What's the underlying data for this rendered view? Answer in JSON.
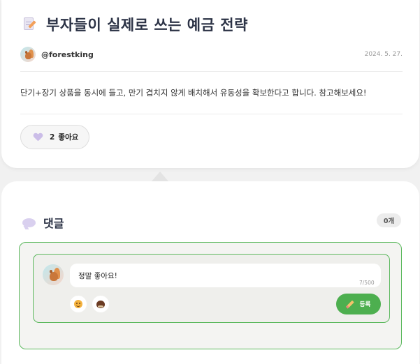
{
  "post": {
    "title": "부자들이 실제로 쓰는 예금 전략",
    "author": "@forestking",
    "date": "2024. 5. 27.",
    "body": "단기+장기 상품을 동시에 들고, 만기 겹치지 않게 배치해서 유동성을 확보한다고 합니다. 참고해보세요!",
    "like_count": "2",
    "like_label": "좋아요"
  },
  "comments": {
    "title": "댓글",
    "count_badge": "0개",
    "input_value": "정말 좋아요!",
    "char_count": "7/500",
    "submit_label": "등록",
    "emoji_buttons": [
      "smile-emoji",
      "chestnut-emoji"
    ]
  },
  "colors": {
    "accent_green": "#4daf4f",
    "title_text": "#2c3346",
    "heart": "#cbbde8"
  }
}
